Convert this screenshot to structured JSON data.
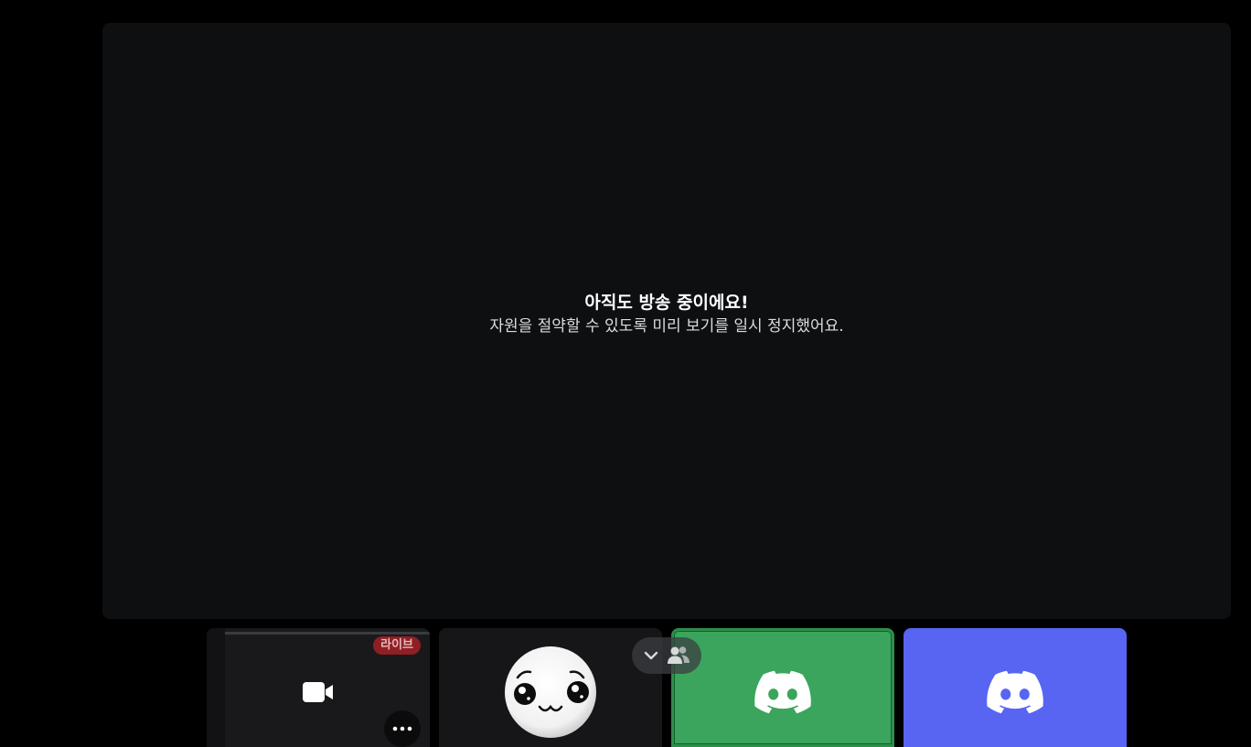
{
  "stream": {
    "paused_title": "아직도 방송 중이에요!",
    "paused_message": "자원을 절약할 수 있도록 미리 보기를 일시 정지했어요."
  },
  "tiles": [
    {
      "kind": "stream",
      "badge": "라이브",
      "icon": "video-camera-icon",
      "menu_icon": "more-icon"
    },
    {
      "kind": "avatar",
      "icon": "smiley-face-avatar"
    },
    {
      "kind": "user",
      "icon": "discord-logo-icon",
      "color": "#3ba55d",
      "speaking": true
    },
    {
      "kind": "user",
      "icon": "discord-logo-icon",
      "color": "#5865f2",
      "speaking": false
    }
  ],
  "controls": {
    "collapse_icon": "chevron-down-icon",
    "participants_icon": "people-icon"
  },
  "colors": {
    "background": "#000000",
    "stage": "#0e0f11",
    "live_badge": "#8e1f24",
    "green_tile": "#3ba55d",
    "blurple_tile": "#5865f2"
  }
}
